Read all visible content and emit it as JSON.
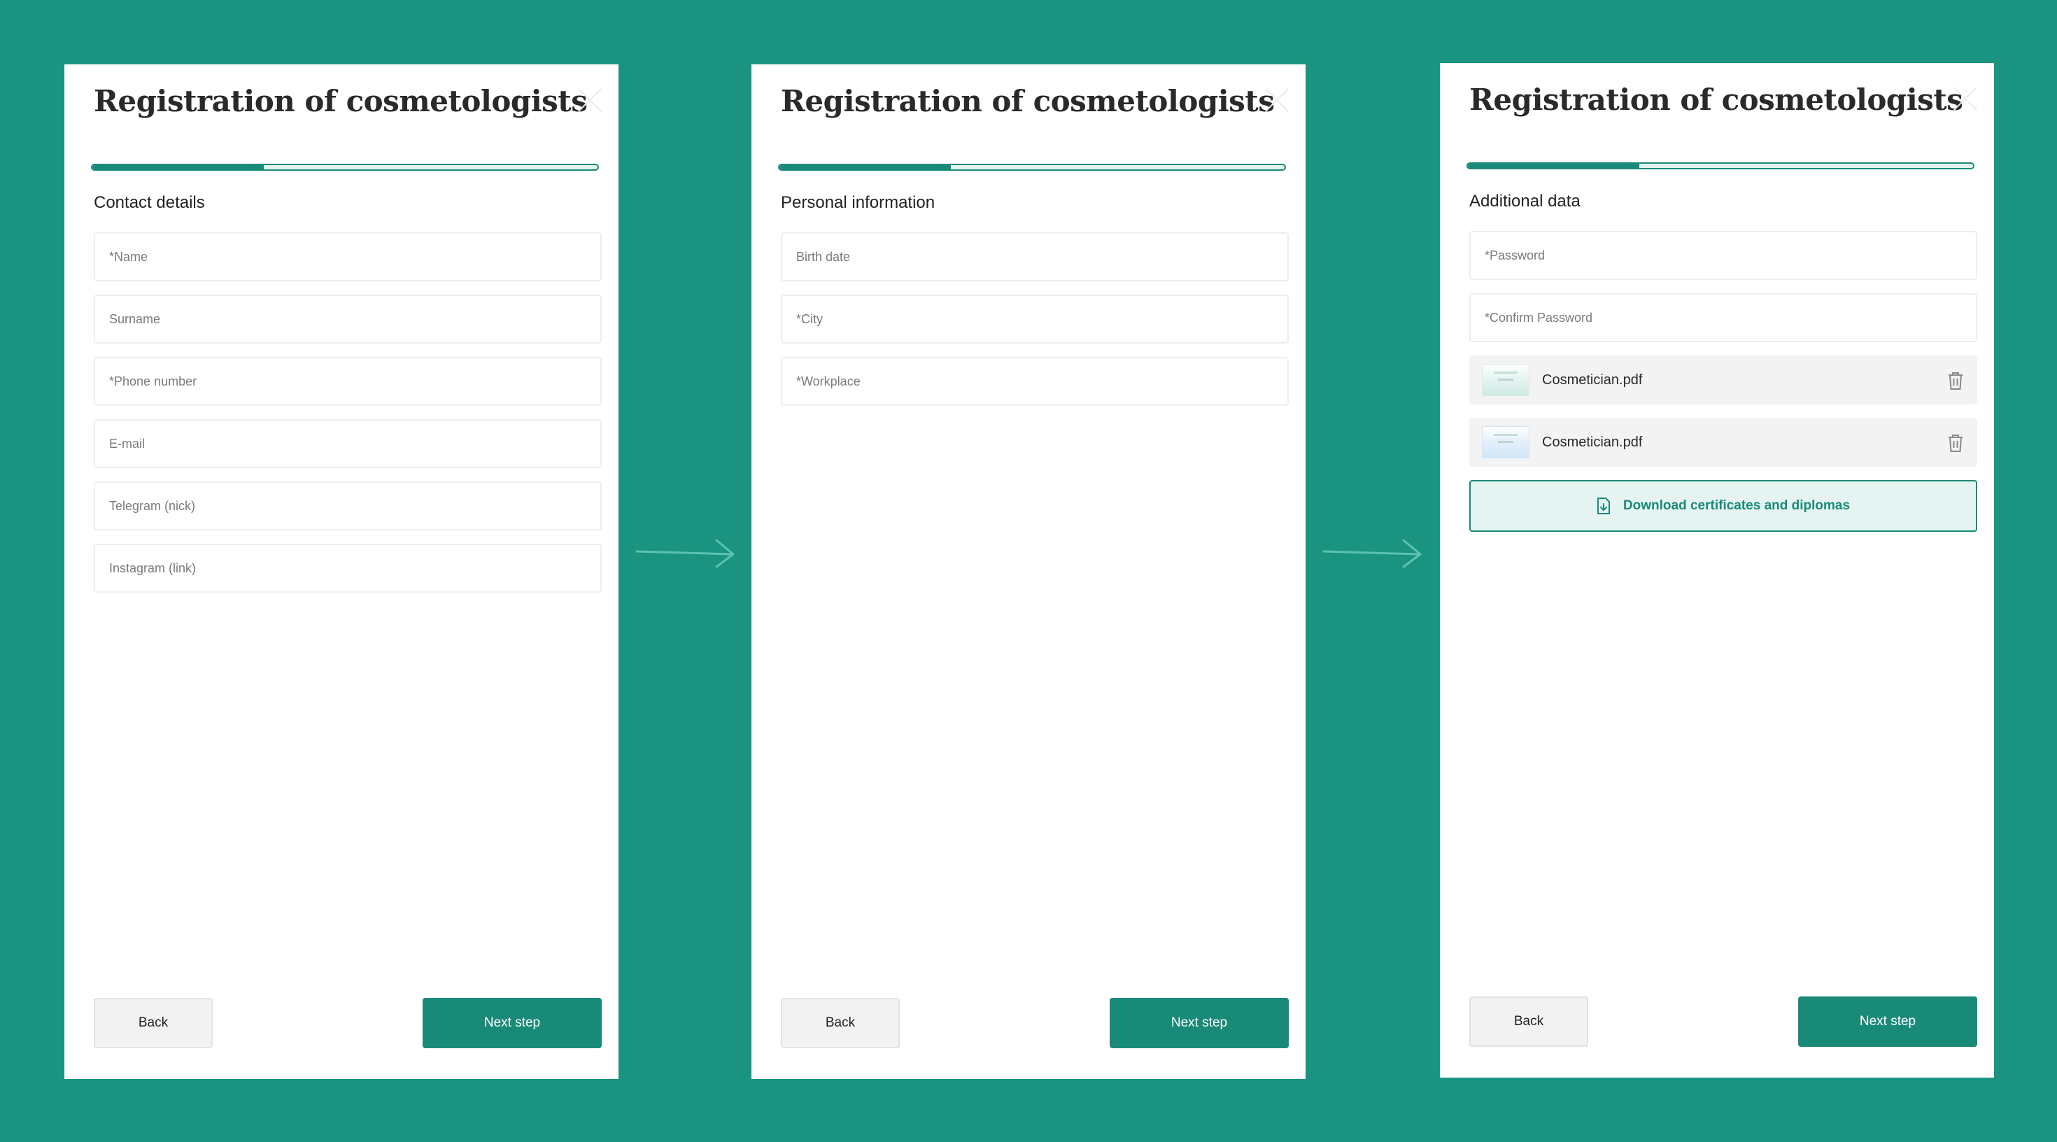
{
  "panels": [
    {
      "title": "Registration of cosmetologists",
      "progress": 0.34,
      "section": "Contact details",
      "fields": [
        "*Name",
        "Surname",
        "*Phone number",
        "E-mail",
        "Telegram (nick)",
        "Instagram (link)"
      ],
      "back_label": "Back",
      "next_label": "Next step"
    },
    {
      "title": "Registration of cosmetologists",
      "progress": 0.34,
      "section": "Personal information",
      "fields": [
        "Birth date",
        "*City",
        "*Workplace"
      ],
      "back_label": "Back",
      "next_label": "Next step"
    },
    {
      "title": "Registration of cosmetologists",
      "progress": 0.34,
      "section": "Additional data",
      "fields": [
        "*Password",
        "*Confirm Password"
      ],
      "files": [
        "Cosmetician.pdf",
        "Cosmetician.pdf"
      ],
      "download_label": "Download certificates and diplomas",
      "back_label": "Back",
      "next_label": "Next step"
    }
  ],
  "icons": {
    "close": "close-icon",
    "trash": "trash-icon",
    "file": "file-download-icon",
    "arrow": "arrow-right-icon"
  },
  "colors": {
    "background": "#1a9480",
    "accent": "#1a8a78",
    "progress_track": "#e4f3f0",
    "download_bg": "#e6f4f1"
  }
}
